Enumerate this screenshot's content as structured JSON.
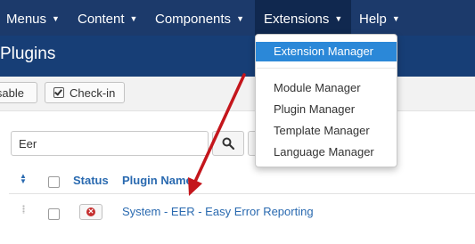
{
  "topnav": {
    "items": [
      {
        "label": "Menus"
      },
      {
        "label": "Content"
      },
      {
        "label": "Components"
      },
      {
        "label": "Extensions"
      },
      {
        "label": "Help"
      }
    ]
  },
  "page": {
    "title": "Plugins"
  },
  "toolbar": {
    "disable_label": "isable",
    "checkin_label": "Check-in"
  },
  "search": {
    "value": "Eer"
  },
  "table": {
    "headers": {
      "status": "Status",
      "name": "Plugin Name"
    },
    "rows": [
      {
        "name": "System - EER - Easy Error Reporting",
        "status": "disabled"
      }
    ]
  },
  "extensions_menu": {
    "items": [
      {
        "label": "Extension Manager",
        "active": true
      },
      {
        "label": "Module Manager"
      },
      {
        "label": "Plugin Manager"
      },
      {
        "label": "Template Manager"
      },
      {
        "label": "Language Manager"
      }
    ]
  },
  "colors": {
    "topbar": "#1c3a6b",
    "titlebar": "#173e76",
    "link": "#2a6ab0",
    "highlight": "#2b88d8",
    "annotation_arrow": "#c4161c"
  }
}
